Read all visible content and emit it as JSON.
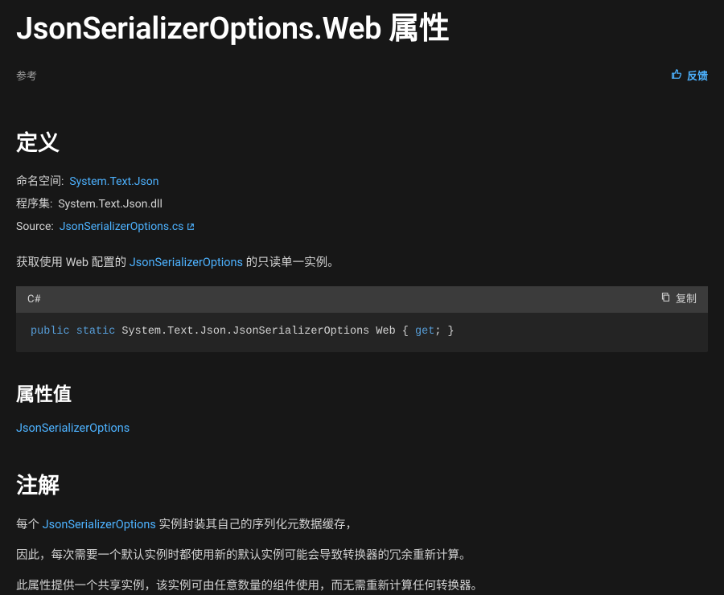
{
  "title": "JsonSerializerOptions.Web 属性",
  "meta": {
    "reference": "参考",
    "feedback": "反馈"
  },
  "definition": {
    "heading": "定义",
    "namespace_k": "命名空间:",
    "namespace_v": "System.Text.Json",
    "assembly_k": "程序集:",
    "assembly_v": "System.Text.Json.dll",
    "source_k": "Source:",
    "source_v": "JsonSerializerOptions.cs",
    "summary_pre": "获取使用 Web 配置的 ",
    "summary_link": "JsonSerializerOptions",
    "summary_post": " 的只读单一实例。"
  },
  "code": {
    "lang": "C#",
    "copy": "复制",
    "kw_public": "public",
    "kw_static": "static",
    "type_and_name": " System.Text.Json.JsonSerializerOptions Web { ",
    "kw_get": "get",
    "tail": "; }"
  },
  "propvalue": {
    "heading": "属性值",
    "link": "JsonSerializerOptions"
  },
  "remarks": {
    "heading": "注解",
    "p1_pre": "每个 ",
    "p1_link": "JsonSerializerOptions",
    "p1_post": " 实例封装其自己的序列化元数据缓存，",
    "p2": "因此，每次需要一个默认实例时都使用新的默认实例可能会导致转换器的冗余重新计算。",
    "p3": "此属性提供一个共享实例，该实例可由任意数量的组件使用，而无需重新计算任何转换器。"
  }
}
